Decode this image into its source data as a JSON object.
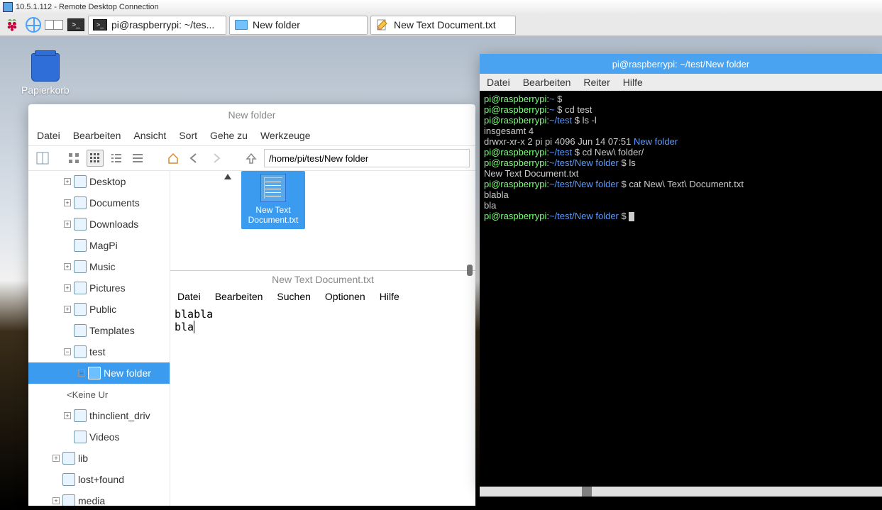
{
  "rdp": {
    "title": "10.5.1.112 - Remote Desktop Connection"
  },
  "taskbar": {
    "items": [
      {
        "name": "terminal-task",
        "label": "pi@raspberrypi: ~/tes..."
      },
      {
        "name": "fm-task",
        "label": "New folder"
      },
      {
        "name": "editor-task",
        "label": "New Text Document.txt"
      }
    ]
  },
  "desktop": {
    "trash_label": "Papierkorb"
  },
  "fm": {
    "title": "New folder",
    "menu": [
      "Datei",
      "Bearbeiten",
      "Ansicht",
      "Sort",
      "Gehe zu",
      "Werkzeuge"
    ],
    "path": "/home/pi/test/New folder",
    "tree": [
      {
        "label": "Desktop",
        "exp": "plus",
        "indent": 0,
        "icon": "folder"
      },
      {
        "label": "Documents",
        "exp": "plus",
        "indent": 0,
        "icon": "folder"
      },
      {
        "label": "Downloads",
        "exp": "plus",
        "indent": 0,
        "icon": "down"
      },
      {
        "label": "MagPi",
        "exp": "none",
        "indent": 0,
        "icon": "folder"
      },
      {
        "label": "Music",
        "exp": "plus",
        "indent": 0,
        "icon": "music"
      },
      {
        "label": "Pictures",
        "exp": "plus",
        "indent": 0,
        "icon": "pic"
      },
      {
        "label": "Public",
        "exp": "plus",
        "indent": 0,
        "icon": "share"
      },
      {
        "label": "Templates",
        "exp": "none",
        "indent": 0,
        "icon": "folder"
      },
      {
        "label": "test",
        "exp": "minus",
        "indent": 0,
        "icon": "folder"
      },
      {
        "label": "New folder",
        "exp": "minus",
        "indent": 1,
        "icon": "folder",
        "selected": true
      },
      {
        "label": "<Keine Ur",
        "exp": "none",
        "indent": 2,
        "icon": "",
        "sub": true
      },
      {
        "label": "thinclient_driv",
        "exp": "plus",
        "indent": 0,
        "icon": "folder"
      },
      {
        "label": "Videos",
        "exp": "none",
        "indent": 0,
        "icon": "video"
      },
      {
        "label": "lib",
        "exp": "plus",
        "indent": -1,
        "icon": "folder"
      },
      {
        "label": "lost+found",
        "exp": "none",
        "indent": -1,
        "icon": "folder"
      },
      {
        "label": "media",
        "exp": "plus",
        "indent": -1,
        "icon": "folder"
      }
    ],
    "file_item": {
      "name": "New Text Document.txt"
    }
  },
  "editor": {
    "title": "New Text Document.txt",
    "menu": [
      "Datei",
      "Bearbeiten",
      "Suchen",
      "Optionen",
      "Hilfe"
    ],
    "content": "blabla\nbla"
  },
  "terminal": {
    "title": "pi@raspberrypi: ~/test/New folder",
    "menu": [
      "Datei",
      "Bearbeiten",
      "Reiter",
      "Hilfe"
    ],
    "lines": [
      {
        "segments": [
          {
            "c": "g",
            "t": "pi@raspberrypi"
          },
          {
            "c": "w",
            "t": ":"
          },
          {
            "c": "b",
            "t": "~"
          },
          {
            "c": "w",
            "t": " $"
          }
        ]
      },
      {
        "segments": [
          {
            "c": "g",
            "t": "pi@raspberrypi"
          },
          {
            "c": "w",
            "t": ":"
          },
          {
            "c": "b",
            "t": "~"
          },
          {
            "c": "w",
            "t": " $ cd test"
          }
        ]
      },
      {
        "segments": [
          {
            "c": "g",
            "t": "pi@raspberrypi"
          },
          {
            "c": "w",
            "t": ":"
          },
          {
            "c": "b",
            "t": "~/test"
          },
          {
            "c": "w",
            "t": " $ ls -l"
          }
        ]
      },
      {
        "segments": [
          {
            "c": "w",
            "t": "insgesamt 4"
          }
        ]
      },
      {
        "segments": [
          {
            "c": "w",
            "t": "drwxr-xr-x 2 pi pi 4096 Jun 14 07:51 "
          },
          {
            "c": "b",
            "t": "New folder"
          }
        ]
      },
      {
        "segments": [
          {
            "c": "g",
            "t": "pi@raspberrypi"
          },
          {
            "c": "w",
            "t": ":"
          },
          {
            "c": "b",
            "t": "~/test"
          },
          {
            "c": "w",
            "t": " $ cd New\\ folder/"
          }
        ]
      },
      {
        "segments": [
          {
            "c": "g",
            "t": "pi@raspberrypi"
          },
          {
            "c": "w",
            "t": ":"
          },
          {
            "c": "b",
            "t": "~/test/New folder"
          },
          {
            "c": "w",
            "t": " $ ls"
          }
        ]
      },
      {
        "segments": [
          {
            "c": "w",
            "t": "New Text Document.txt"
          }
        ]
      },
      {
        "segments": [
          {
            "c": "g",
            "t": "pi@raspberrypi"
          },
          {
            "c": "w",
            "t": ":"
          },
          {
            "c": "b",
            "t": "~/test/New folder"
          },
          {
            "c": "w",
            "t": " $ cat New\\ Text\\ Document.txt"
          }
        ]
      },
      {
        "segments": [
          {
            "c": "w",
            "t": "blabla"
          }
        ]
      },
      {
        "segments": [
          {
            "c": "w",
            "t": "bla"
          }
        ]
      },
      {
        "segments": [
          {
            "c": "g",
            "t": "pi@raspberrypi"
          },
          {
            "c": "w",
            "t": ":"
          },
          {
            "c": "b",
            "t": "~/test/New folder"
          },
          {
            "c": "w",
            "t": " $ "
          }
        ],
        "cursor": true
      }
    ]
  }
}
